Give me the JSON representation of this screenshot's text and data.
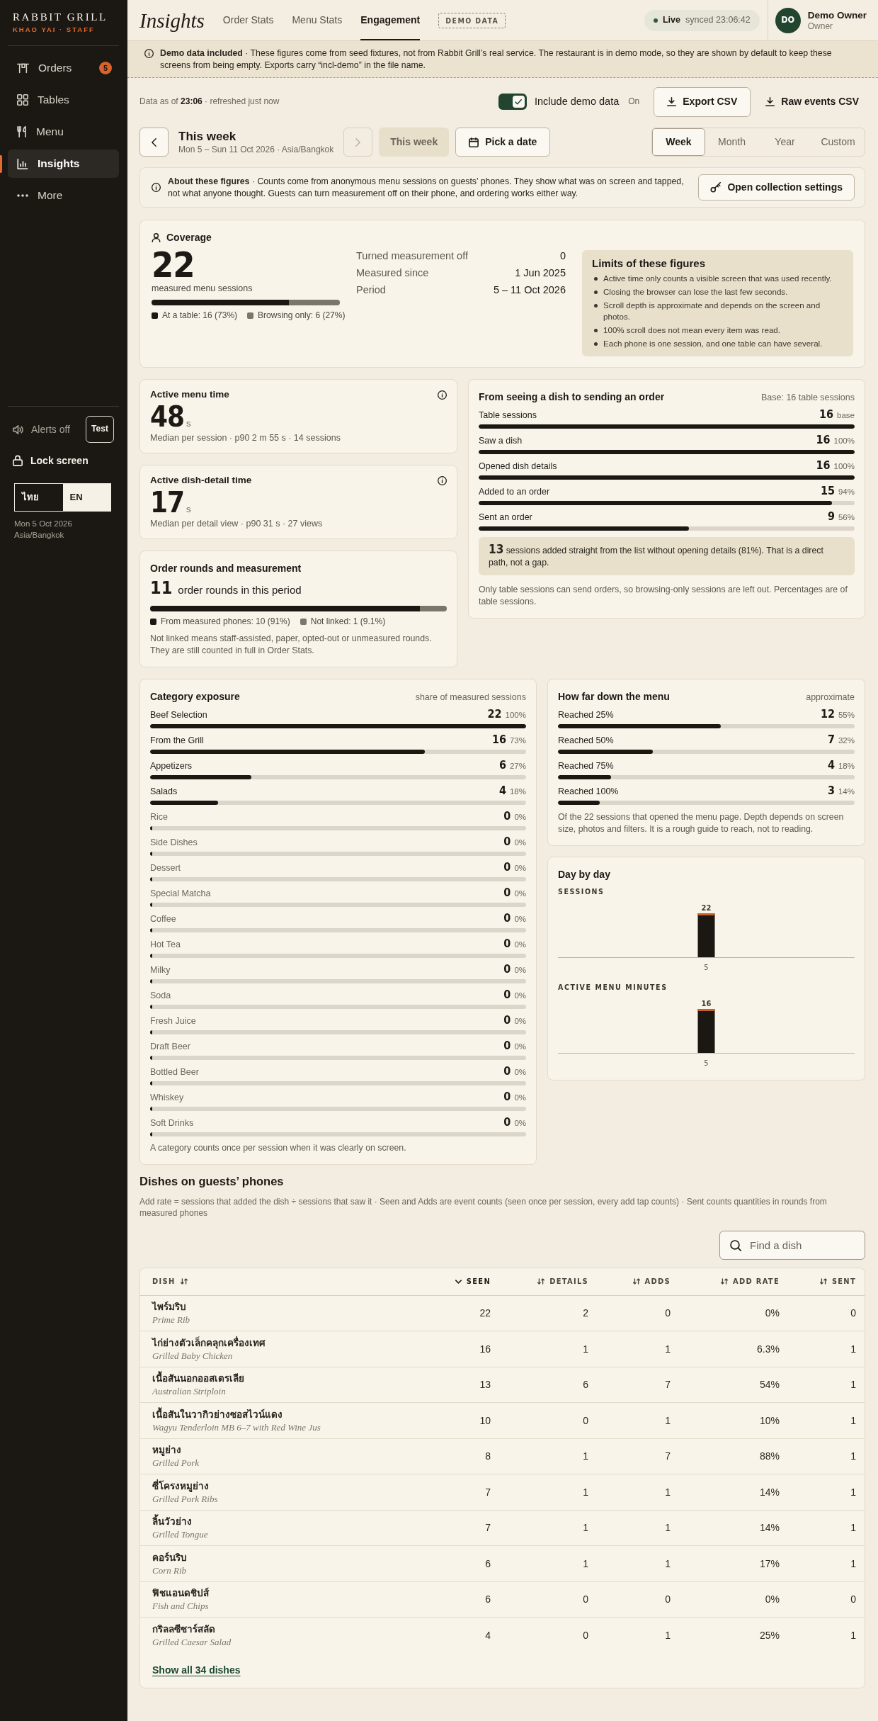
{
  "sidebar": {
    "brand": "RABBIT GRILL",
    "subtitle": "KHAO YAI · STAFF",
    "items": [
      {
        "label": "Orders",
        "badge": "5",
        "selected": false
      },
      {
        "label": "Tables",
        "selected": false
      },
      {
        "label": "Menu",
        "selected": false
      },
      {
        "label": "Insights",
        "selected": true
      },
      {
        "label": "More",
        "selected": false
      }
    ],
    "alerts": {
      "label": "Alerts off",
      "button": "Test"
    },
    "lock_screen": "Lock screen",
    "languages": [
      {
        "label": "ไทย",
        "selected": false
      },
      {
        "label": "EN",
        "selected": true
      }
    ],
    "date": "Mon 5 Oct 2026",
    "timezone": "Asia/Bangkok"
  },
  "header": {
    "title": "Insights",
    "tabs": [
      {
        "label": "Order Stats",
        "selected": false
      },
      {
        "label": "Menu Stats",
        "selected": false
      },
      {
        "label": "Engagement",
        "selected": true
      }
    ],
    "tag": "DEMO DATA",
    "live": {
      "label": "Live",
      "synced": "synced 23:06:42"
    },
    "user": {
      "initials": "DO",
      "name": "Demo Owner",
      "role": "Owner"
    }
  },
  "banner": {
    "text": "**Demo data included** · These figures come from seed fixtures, not from Rabbit Grill’s real service. The restaurant is in demo mode, so they are shown by default to keep these screens from being empty. Exports carry “incl-demo” in the file name."
  },
  "toolbar": {
    "data_as_of": "Data as of **23:06** · refreshed just now",
    "demo_toggle": {
      "label": "Include demo data",
      "checked": true,
      "state": "On"
    },
    "buttons": [
      {
        "label": "Export CSV",
        "kind": "outline"
      },
      {
        "label": "Raw events CSV",
        "kind": "plain"
      }
    ]
  },
  "period": {
    "prev": {
      "disabled": false
    },
    "title": "This week",
    "subtitle": "Mon 5 – Sun 11 Oct 2026 · Asia/Bangkok",
    "next": {
      "disabled": true
    },
    "this_week": {
      "label": "This week",
      "disabled": true
    },
    "pick": "Pick a date",
    "ranges": [
      {
        "label": "Week",
        "selected": true
      },
      {
        "label": "Month",
        "selected": false
      },
      {
        "label": "Year",
        "selected": false
      },
      {
        "label": "Custom",
        "selected": false
      }
    ]
  },
  "about": {
    "text": "**About these figures** · Counts come from anonymous menu sessions on guests’ phones. They show what was on screen and tapped, not what anyone thought. Guests can turn measurement off on their phone, and ordering works either way.",
    "button": "Open collection settings"
  },
  "coverage": {
    "title": "Coverage",
    "value": "22",
    "caption": "measured menu sessions",
    "split": [
      {
        "label": "At a table: 16 (73%)",
        "level": 0.73,
        "color": "#1b1814"
      },
      {
        "label": "Browsing only: 6 (27%)",
        "level": 0.27,
        "color": "#7b766c"
      }
    ],
    "stats": [
      {
        "label": "Turned measurement off",
        "value": "0"
      },
      {
        "label": "Measured since",
        "value": "1 Jun 2025"
      },
      {
        "label": "Period",
        "value": "5 – 11 Oct 2026"
      }
    ],
    "limits": {
      "title": "Limits of these figures",
      "items": [
        "Active time only counts a visible screen that was used recently.",
        "Closing the browser can lose the last few seconds.",
        "Scroll depth is approximate and depends on the screen and photos.",
        "100% scroll does not mean every item was read.",
        "Each phone is one session, and one table can have several."
      ]
    }
  },
  "metrics": [
    {
      "title": "Active menu time",
      "value": "48",
      "unit": "s",
      "caption": "Median per session · p90 2 m 55 s · 14 sessions"
    },
    {
      "title": "Active dish-detail time",
      "value": "17",
      "unit": "s",
      "caption": "Median per detail view · p90 31 s · 27 views"
    }
  ],
  "order_rounds": {
    "title": "Order rounds and measurement",
    "value": "11",
    "caption": "order rounds in this period",
    "split": [
      {
        "label": "From measured phones: 10 (91%)",
        "level": 0.91,
        "color": "#1b1814"
      },
      {
        "label": "Not linked: 1 (9.1%)",
        "level": 0.09,
        "color": "#7b766c"
      }
    ],
    "note": "Not linked means staff-assisted, paper, opted-out or unmeasured rounds. They are still counted in full in Order Stats."
  },
  "funnel": {
    "title": "From seeing a dish to sending an order",
    "base": "Base: 16 table sessions",
    "steps": [
      {
        "label": "Table sessions",
        "count": "16",
        "share": "base",
        "level": 1
      },
      {
        "label": "Saw a dish",
        "count": "16",
        "share": "100%",
        "level": 1
      },
      {
        "label": "Opened dish details",
        "count": "16",
        "share": "100%",
        "level": 1
      },
      {
        "label": "Added to an order",
        "count": "15",
        "share": "94%",
        "level": 0.94
      },
      {
        "label": "Sent an order",
        "count": "9",
        "share": "56%",
        "level": 0.56
      }
    ],
    "callout": "**13** sessions added straight from the list without opening details (81%). That is a direct path, not a gap.",
    "note": "Only table sessions can send orders, so browsing-only sessions are left out. Percentages are of table sessions."
  },
  "categories": {
    "title": "Category exposure",
    "subtitle": "share of measured sessions",
    "rows": [
      {
        "label": "Beef Selection",
        "count": "22",
        "share": "100%",
        "level": 1
      },
      {
        "label": "From the Grill",
        "count": "16",
        "share": "73%",
        "level": 0.73
      },
      {
        "label": "Appetizers",
        "count": "6",
        "share": "27%",
        "level": 0.27
      },
      {
        "label": "Salads",
        "count": "4",
        "share": "18%",
        "level": 0.18
      },
      {
        "label": "Rice",
        "count": "0",
        "share": "0%",
        "level": 0
      },
      {
        "label": "Side Dishes",
        "count": "0",
        "share": "0%",
        "level": 0
      },
      {
        "label": "Dessert",
        "count": "0",
        "share": "0%",
        "level": 0
      },
      {
        "label": "Special Matcha",
        "count": "0",
        "share": "0%",
        "level": 0
      },
      {
        "label": "Coffee",
        "count": "0",
        "share": "0%",
        "level": 0
      },
      {
        "label": "Hot Tea",
        "count": "0",
        "share": "0%",
        "level": 0
      },
      {
        "label": "Milky",
        "count": "0",
        "share": "0%",
        "level": 0
      },
      {
        "label": "Soda",
        "count": "0",
        "share": "0%",
        "level": 0
      },
      {
        "label": "Fresh Juice",
        "count": "0",
        "share": "0%",
        "level": 0
      },
      {
        "label": "Draft Beer",
        "count": "0",
        "share": "0%",
        "level": 0
      },
      {
        "label": "Bottled Beer",
        "count": "0",
        "share": "0%",
        "level": 0
      },
      {
        "label": "Whiskey",
        "count": "0",
        "share": "0%",
        "level": 0
      },
      {
        "label": "Soft Drinks",
        "count": "0",
        "share": "0%",
        "level": 0
      }
    ],
    "note": "A category counts once per session when it was clearly on screen."
  },
  "depth": {
    "title": "How far down the menu",
    "subtitle": "approximate",
    "rows": [
      {
        "label": "Reached 25%",
        "count": "12",
        "share": "55%",
        "level": 0.55
      },
      {
        "label": "Reached 50%",
        "count": "7",
        "share": "32%",
        "level": 0.32
      },
      {
        "label": "Reached 75%",
        "count": "4",
        "share": "18%",
        "level": 0.18
      },
      {
        "label": "Reached 100%",
        "count": "3",
        "share": "14%",
        "level": 0.14
      }
    ],
    "note": "Of the 22 sessions that opened the menu page. Depth depends on screen size, photos and filters. It is a rough guide to reach, not to reading."
  },
  "day_by_day": {
    "title": "Day by day",
    "charts": [
      {
        "chart_data": {
          "type": "bar",
          "title": "SESSIONS",
          "categories": [
            "5"
          ],
          "values": [
            22
          ],
          "data_labels": true
        }
      },
      {
        "chart_data": {
          "type": "bar",
          "title": "ACTIVE MENU MINUTES",
          "categories": [
            "5"
          ],
          "values": [
            16
          ],
          "data_labels": true
        }
      }
    ]
  },
  "dishes": {
    "title": "Dishes on guests’ phones",
    "description": "Add rate = sessions that added the dish ÷ sessions that saw it · Seen and Adds are event counts (seen once per session, every add tap counts) · Sent counts quantities in rounds from measured phones",
    "search": {
      "placeholder": "Find a dish"
    },
    "columns": [
      {
        "label": "DISH",
        "sorted": false
      },
      {
        "label": "SEEN",
        "sorted": true
      },
      {
        "label": "DETAILS",
        "sorted": false
      },
      {
        "label": "ADDS",
        "sorted": false
      },
      {
        "label": "ADD RATE",
        "sorted": false
      },
      {
        "label": "SENT",
        "sorted": false
      }
    ],
    "rows": [
      {
        "name": "ไพร์มริบ",
        "english": "Prime Rib",
        "seen": "22",
        "details": "2",
        "adds": "0",
        "add_rate": "0%",
        "sent": "0"
      },
      {
        "name": "ไก่ย่างตัวเล็กคลุกเครื่องเทศ",
        "english": "Grilled Baby Chicken",
        "seen": "16",
        "details": "1",
        "adds": "1",
        "add_rate": "6.3%",
        "sent": "1"
      },
      {
        "name": "เนื้อสันนอกออสเตรเลีย",
        "english": "Australian Striploin",
        "seen": "13",
        "details": "6",
        "adds": "7",
        "add_rate": "54%",
        "sent": "1"
      },
      {
        "name": "เนื้อสันในวากิวย่างซอสไวน์แดง",
        "english": "Wagyu Tenderloin MB 6–7 with Red Wine Jus",
        "seen": "10",
        "details": "0",
        "adds": "1",
        "add_rate": "10%",
        "sent": "1"
      },
      {
        "name": "หมูย่าง",
        "english": "Grilled Pork",
        "seen": "8",
        "details": "1",
        "adds": "7",
        "add_rate": "88%",
        "sent": "1"
      },
      {
        "name": "ซี่โครงหมูย่าง",
        "english": "Grilled Pork Ribs",
        "seen": "7",
        "details": "1",
        "adds": "1",
        "add_rate": "14%",
        "sent": "1"
      },
      {
        "name": "ลิ้นวัวย่าง",
        "english": "Grilled Tongue",
        "seen": "7",
        "details": "1",
        "adds": "1",
        "add_rate": "14%",
        "sent": "1"
      },
      {
        "name": "คอร์นริบ",
        "english": "Corn Rib",
        "seen": "6",
        "details": "1",
        "adds": "1",
        "add_rate": "17%",
        "sent": "1"
      },
      {
        "name": "ฟิชแอนดชิปส์",
        "english": "Fish and Chips",
        "seen": "6",
        "details": "0",
        "adds": "0",
        "add_rate": "0%",
        "sent": "0"
      },
      {
        "name": "กริลลซีซาร์สลัด",
        "english": "Grilled Caesar Salad",
        "seen": "4",
        "details": "0",
        "adds": "1",
        "add_rate": "25%",
        "sent": "1"
      }
    ],
    "show_all": "Show all 34 dishes"
  }
}
